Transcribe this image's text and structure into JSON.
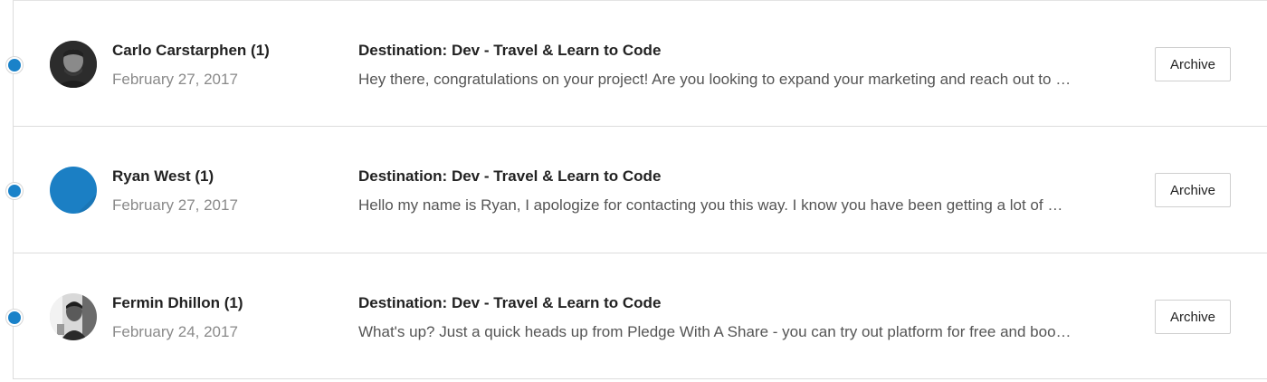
{
  "messages": [
    {
      "sender": "Carlo Carstarphen (1)",
      "date": "February 27, 2017",
      "subject": "Destination: Dev - Travel & Learn to Code",
      "preview": "Hey there, congratulations on your project! Are you looking to expand your marketing and reach out to more backers?",
      "avatar": "photo-avatar",
      "archive_label": "Archive"
    },
    {
      "sender": "Ryan West (1)",
      "date": "February 27, 2017",
      "subject": "Destination: Dev - Travel & Learn to Code",
      "preview": "Hello my name is Ryan, I apologize for contacting you this way. I know you have been getting a lot of messages",
      "avatar": "blue-avatar",
      "archive_label": "Archive"
    },
    {
      "sender": "Fermin Dhillon (1)",
      "date": "February 24, 2017",
      "subject": "Destination: Dev - Travel & Learn to Code",
      "preview": "What's up? Just a quick heads up from Pledge With A Share - you can try out platform for free and boost your campaign",
      "avatar": "photo-avatar",
      "archive_label": "Archive"
    }
  ],
  "colors": {
    "unread_dot": "#1a82c9",
    "blue_avatar": "#1b7fc4",
    "border": "#dcdcdc"
  }
}
